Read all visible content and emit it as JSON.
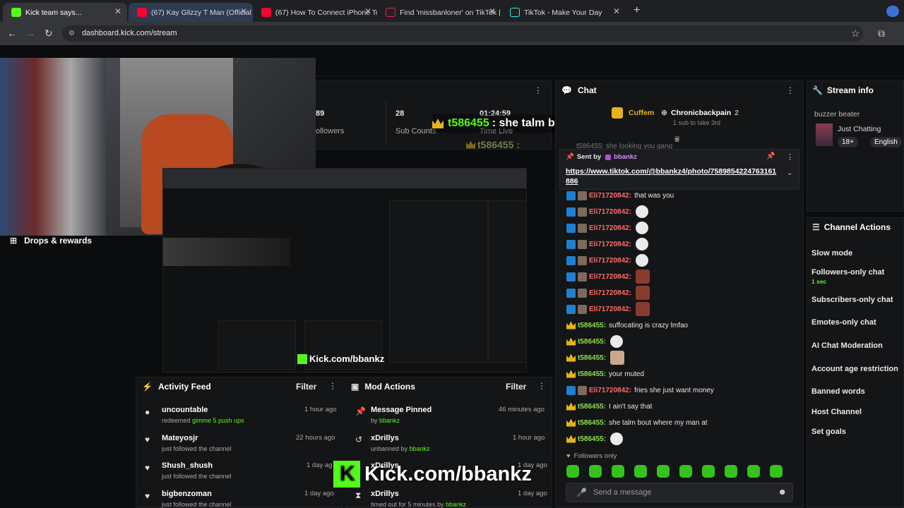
{
  "tabs": [
    {
      "title": "Kick team says...",
      "color": "#53fc18"
    },
    {
      "title": "(67) Kay Glizzy T Man (Official",
      "color": "#ff0033"
    },
    {
      "title": "(67) How To Connect iPhone To",
      "color": "#ff0033"
    },
    {
      "title": "Find 'missbanloner' on TikTok |",
      "color": "#111111"
    },
    {
      "title": "TikTok - Make Your Day",
      "color": "#111111"
    }
  ],
  "url": "dashboard.kick.com/stream",
  "stats": {
    "followers_value": "89",
    "followers_label": "ollowers",
    "subs_value": "28",
    "subs_label": "Sub Counts",
    "time_value": "01:24:59",
    "time_label": "Time Live"
  },
  "overlay": {
    "user": "t586455",
    "message": ": she talm bout where my man at",
    "echo": "t586455 :"
  },
  "left": {
    "drops": "Drops & rewards"
  },
  "chat": {
    "title": "Chat",
    "top_user": "Cuffem",
    "top_user2": "Chronicbackpain",
    "top_count": "2",
    "top_note": "1 sub to take 3rd",
    "partial": "t586455: she looking you gang",
    "pinned_label": "Sent by",
    "pinned_user": "bbankz",
    "pinned_link": "https://www.tiktok.com/@bbankz4/photo/7589854224763161886",
    "lines": [
      {
        "user": "Eli71720842:",
        "text": "that was you",
        "type": "mod",
        "emote": ""
      },
      {
        "user": "Eli71720842:",
        "text": "",
        "type": "mod",
        "emote": "ghost"
      },
      {
        "user": "Eli71720842:",
        "text": "",
        "type": "mod",
        "emote": "ghost"
      },
      {
        "user": "Eli71720842:",
        "text": "",
        "type": "mod",
        "emote": "ghost"
      },
      {
        "user": "Eli71720842:",
        "text": "",
        "type": "mod",
        "emote": "ghost"
      },
      {
        "user": "Eli71720842:",
        "text": "",
        "type": "mod",
        "emote": "face"
      },
      {
        "user": "Eli71720842:",
        "text": "",
        "type": "mod",
        "emote": "face"
      },
      {
        "user": "Eli71720842:",
        "text": "",
        "type": "mod",
        "emote": "face"
      },
      {
        "user": "t586455:",
        "text": "suffocating is crazy lmfao",
        "type": "crown",
        "emote": ""
      },
      {
        "user": "t586455:",
        "text": "",
        "type": "crown",
        "emote": "ghost"
      },
      {
        "user": "t586455:",
        "text": "",
        "type": "crown",
        "emote": "man"
      },
      {
        "user": "t586455:",
        "text": "your muted",
        "type": "crown",
        "emote": ""
      },
      {
        "user": "Eli71720842:",
        "text": "fries she just want money",
        "type": "mod",
        "emote": ""
      },
      {
        "user": "t586455:",
        "text": "I ain't say that",
        "type": "crown",
        "emote": ""
      },
      {
        "user": "t586455:",
        "text": "she talm bout where my man at",
        "type": "crown",
        "emote": ""
      },
      {
        "user": "t586455:",
        "text": "",
        "type": "crown",
        "emote": "ghost"
      }
    ],
    "followers_only": "Followers only",
    "placeholder": "Send a message"
  },
  "stream_info": {
    "title": "Stream info",
    "stream_title": "buzzer beater",
    "category": "Just Chatting",
    "tag1": "18+",
    "tag2": "English"
  },
  "channel_actions": {
    "title": "Channel Actions",
    "items": [
      "Slow mode",
      "Followers-only chat",
      "Subscribers-only chat",
      "Emotes-only chat",
      "AI Chat Moderation",
      "Account age restriction",
      "Banned words",
      "Host Channel",
      "Set goals"
    ],
    "followers_sub": "1 sec"
  },
  "activity": {
    "title": "Activity Feed",
    "filter": "Filter",
    "items": [
      {
        "name": "uncountable",
        "desc_pre": "redeemed ",
        "desc_hl": "gimme 5 push ups",
        "time": "1 hour ago"
      },
      {
        "name": "Mateyosjr",
        "desc_pre": "just followed the channel",
        "desc_hl": "",
        "time": "22 hours ago"
      },
      {
        "name": "Shush_shush",
        "desc_pre": "just followed the channel",
        "desc_hl": "",
        "time": "1 day ag"
      },
      {
        "name": "bigbenzoman",
        "desc_pre": "just followed the channel",
        "desc_hl": "",
        "time": "1 day ago"
      }
    ]
  },
  "mod": {
    "title": "Mod Actions",
    "filter": "Filter",
    "items": [
      {
        "name": "Message Pinned",
        "desc_pre": "by ",
        "desc_hl": "bbankz",
        "time": "46 minutes ago"
      },
      {
        "name": "xDrillys",
        "desc_pre": "unbanned by ",
        "desc_hl": "bbankz",
        "time": "1 hour ago"
      },
      {
        "name": "xDrillys",
        "desc_pre": "",
        "desc_hl": "",
        "time": "1 day ago"
      },
      {
        "name": "xDrillys",
        "desc_pre": "timed out for 5 minutes by ",
        "desc_hl": "bbankz",
        "time": "1 day ago"
      }
    ]
  },
  "watermark": "Kick.com/bbankz",
  "watermark_small": "Kick.com/bbankz",
  "colors": {
    "kick_green": "#53fc18",
    "bg": "#0b0c0d",
    "panel": "#141517"
  }
}
